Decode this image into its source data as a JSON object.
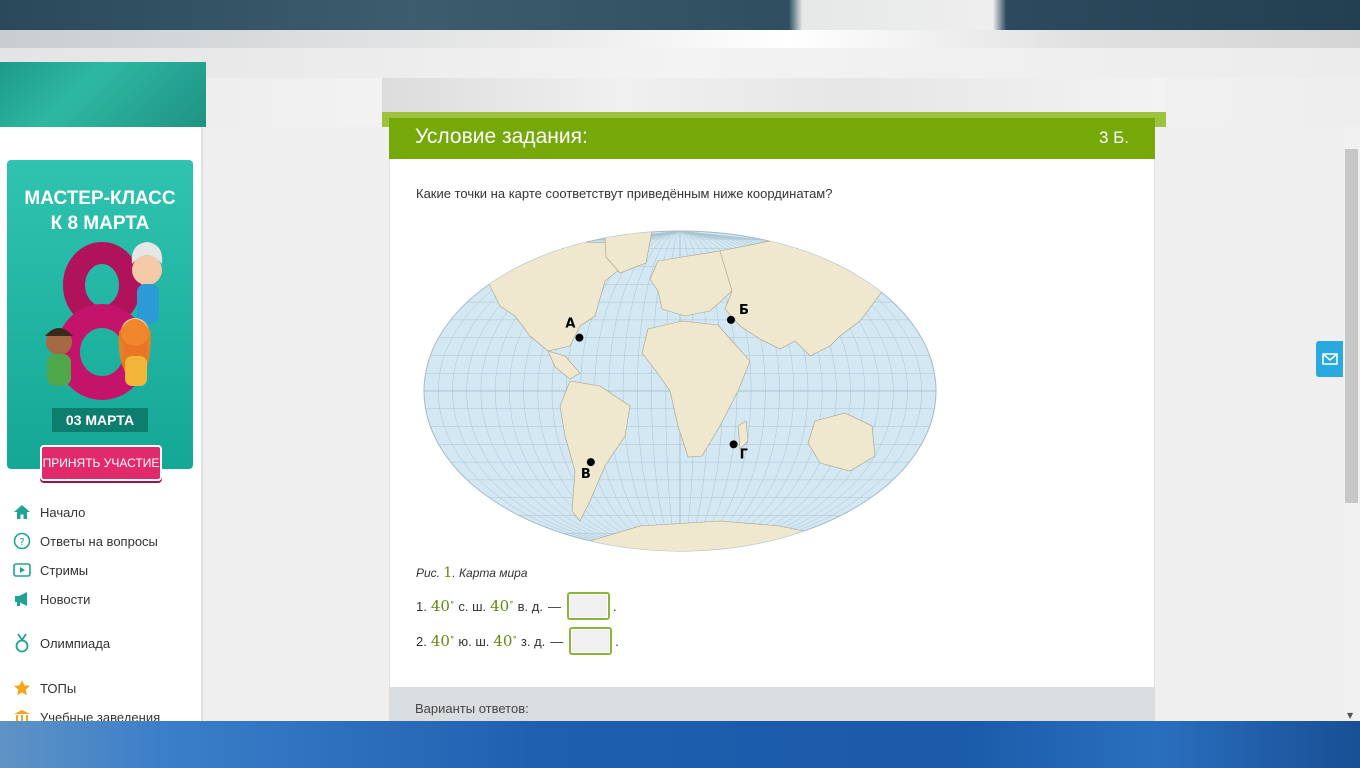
{
  "promo": {
    "title_line1": "МАСТЕР-КЛАСС",
    "title_line2": "К 8 МАРТА",
    "date": "03 МАРТА",
    "button": "ПРИНЯТЬ УЧАСТИЕ"
  },
  "nav": {
    "items": [
      {
        "label": "Начало",
        "icon": "home-icon"
      },
      {
        "label": "Ответы на вопросы",
        "icon": "question-icon"
      },
      {
        "label": "Стримы",
        "icon": "play-icon"
      },
      {
        "label": "Новости",
        "icon": "megaphone-icon"
      },
      {
        "label": "Олимпиада",
        "icon": "medal-icon"
      },
      {
        "label": "ТОПы",
        "icon": "star-icon"
      },
      {
        "label": "Учебные заведения",
        "icon": "institution-icon"
      }
    ]
  },
  "task": {
    "header": "Условие задания:",
    "points": "3 Б.",
    "question": "Какие точки на карте соответствут приведённым ниже координатам?",
    "caption_prefix": "Рис.",
    "caption_num": "1",
    "caption_text": ". Карта мира",
    "map_points": [
      {
        "label": "А",
        "lat": 30,
        "lon": -75
      },
      {
        "label": "Б",
        "lat": 40,
        "lon": 40
      },
      {
        "label": "В",
        "lat": -40,
        "lon": -70
      },
      {
        "label": "Г",
        "lat": -30,
        "lon": 40
      }
    ],
    "items": [
      {
        "num": "1.",
        "lat_value": "40",
        "lat_dir": "с. ш.",
        "lon_value": "40",
        "lon_dir": "в. д.",
        "dash": "—",
        "end": "."
      },
      {
        "num": "2.",
        "lat_value": "40",
        "lat_dir": "ю. ш.",
        "lon_value": "40",
        "lon_dir": "з. д.",
        "dash": "—",
        "end": "."
      }
    ],
    "degree": "∘",
    "answers_label": "Варианты ответов:"
  },
  "colors": {
    "header_green": "#75a90a",
    "ocean": "#d3e8f3",
    "land": "#efe8cf",
    "promo_teal": "#1fb3a1",
    "promo_button": "#e02a6b",
    "nav_icon": "#1fa394"
  }
}
